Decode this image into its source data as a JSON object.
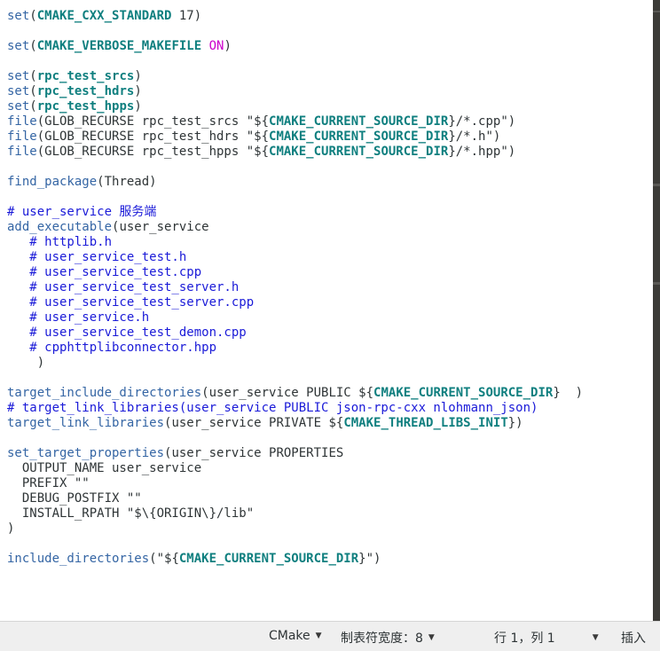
{
  "code_lines": [
    [
      {
        "t": "set",
        "c": "kw"
      },
      {
        "t": "(",
        "c": "pl"
      },
      {
        "t": "CMAKE_CXX_STANDARD",
        "c": "var"
      },
      {
        "t": " 17)",
        "c": "pl"
      }
    ],
    [],
    [
      {
        "t": "set",
        "c": "kw"
      },
      {
        "t": "(",
        "c": "pl"
      },
      {
        "t": "CMAKE_VERBOSE_MAKEFILE",
        "c": "var"
      },
      {
        "t": " ",
        "c": "pl"
      },
      {
        "t": "ON",
        "c": "on"
      },
      {
        "t": ")",
        "c": "pl"
      }
    ],
    [],
    [
      {
        "t": "set",
        "c": "kw"
      },
      {
        "t": "(",
        "c": "pl"
      },
      {
        "t": "rpc_test_srcs",
        "c": "var"
      },
      {
        "t": ")",
        "c": "pl"
      }
    ],
    [
      {
        "t": "set",
        "c": "kw"
      },
      {
        "t": "(",
        "c": "pl"
      },
      {
        "t": "rpc_test_hdrs",
        "c": "var"
      },
      {
        "t": ")",
        "c": "pl"
      }
    ],
    [
      {
        "t": "set",
        "c": "kw"
      },
      {
        "t": "(",
        "c": "pl"
      },
      {
        "t": "rpc_test_hpps",
        "c": "var"
      },
      {
        "t": ")",
        "c": "pl"
      }
    ],
    [
      {
        "t": "file",
        "c": "kw"
      },
      {
        "t": "(GLOB_RECURSE rpc_test_srcs \"${",
        "c": "pl"
      },
      {
        "t": "CMAKE_CURRENT_SOURCE_DIR",
        "c": "var"
      },
      {
        "t": "}/*.cpp\")",
        "c": "pl"
      }
    ],
    [
      {
        "t": "file",
        "c": "kw"
      },
      {
        "t": "(GLOB_RECURSE rpc_test_hdrs \"${",
        "c": "pl"
      },
      {
        "t": "CMAKE_CURRENT_SOURCE_DIR",
        "c": "var"
      },
      {
        "t": "}/*.h\")",
        "c": "pl"
      }
    ],
    [
      {
        "t": "file",
        "c": "kw"
      },
      {
        "t": "(GLOB_RECURSE rpc_test_hpps \"${",
        "c": "pl"
      },
      {
        "t": "CMAKE_CURRENT_SOURCE_DIR",
        "c": "var"
      },
      {
        "t": "}/*.hpp\")",
        "c": "pl"
      }
    ],
    [],
    [
      {
        "t": "find_package",
        "c": "kw"
      },
      {
        "t": "(Thread)",
        "c": "pl"
      }
    ],
    [],
    [
      {
        "t": "# user_service 服务端",
        "c": "cm"
      }
    ],
    [
      {
        "t": "add_executable",
        "c": "kw"
      },
      {
        "t": "(user_service",
        "c": "pl"
      }
    ],
    [
      {
        "t": "   # httplib.h",
        "c": "cm"
      }
    ],
    [
      {
        "t": "   # user_service_test.h",
        "c": "cm"
      }
    ],
    [
      {
        "t": "   # user_service_test.cpp",
        "c": "cm"
      }
    ],
    [
      {
        "t": "   # user_service_test_server.h",
        "c": "cm"
      }
    ],
    [
      {
        "t": "   # user_service_test_server.cpp",
        "c": "cm"
      }
    ],
    [
      {
        "t": "   # user_service.h",
        "c": "cm"
      }
    ],
    [
      {
        "t": "   # user_service_test_demon.cpp",
        "c": "cm"
      }
    ],
    [
      {
        "t": "   # cpphttplibconnector.hpp",
        "c": "cm"
      }
    ],
    [
      {
        "t": "    )",
        "c": "pl"
      }
    ],
    [],
    [
      {
        "t": "target_include_directories",
        "c": "kw"
      },
      {
        "t": "(user_service PUBLIC ${",
        "c": "pl"
      },
      {
        "t": "CMAKE_CURRENT_SOURCE_DIR",
        "c": "var"
      },
      {
        "t": "}  )",
        "c": "pl"
      }
    ],
    [
      {
        "t": "# target_link_libraries(user_service PUBLIC json-rpc-cxx nlohmann_json)",
        "c": "cm"
      }
    ],
    [
      {
        "t": "target_link_libraries",
        "c": "kw"
      },
      {
        "t": "(user_service PRIVATE ${",
        "c": "pl"
      },
      {
        "t": "CMAKE_THREAD_LIBS_INIT",
        "c": "var"
      },
      {
        "t": "})",
        "c": "pl"
      }
    ],
    [],
    [
      {
        "t": "set_target_properties",
        "c": "kw"
      },
      {
        "t": "(user_service PROPERTIES",
        "c": "pl"
      }
    ],
    [
      {
        "t": "  OUTPUT_NAME user_service",
        "c": "pl"
      }
    ],
    [
      {
        "t": "  PREFIX \"\"",
        "c": "pl"
      }
    ],
    [
      {
        "t": "  DEBUG_POSTFIX \"\"",
        "c": "pl"
      }
    ],
    [
      {
        "t": "  INSTALL_RPATH \"$\\{ORIGIN\\}/lib\"",
        "c": "pl"
      }
    ],
    [
      {
        "t": ")",
        "c": "pl"
      }
    ],
    [],
    [
      {
        "t": "include_directories",
        "c": "kw"
      },
      {
        "t": "(\"${",
        "c": "pl"
      },
      {
        "t": "CMAKE_CURRENT_SOURCE_DIR",
        "c": "var"
      },
      {
        "t": "}\")",
        "c": "pl"
      }
    ]
  ],
  "statusbar": {
    "language": "CMake",
    "tab_width": "制表符宽度：8",
    "cursor_position": "行 1，列 1",
    "insert_mode": "插入"
  },
  "colors": {
    "keyword": "#3465a4",
    "variable": "#0f7f7f",
    "boolean": "#cc00cc",
    "comment": "#1a1ad8",
    "text": "#2e3436"
  }
}
